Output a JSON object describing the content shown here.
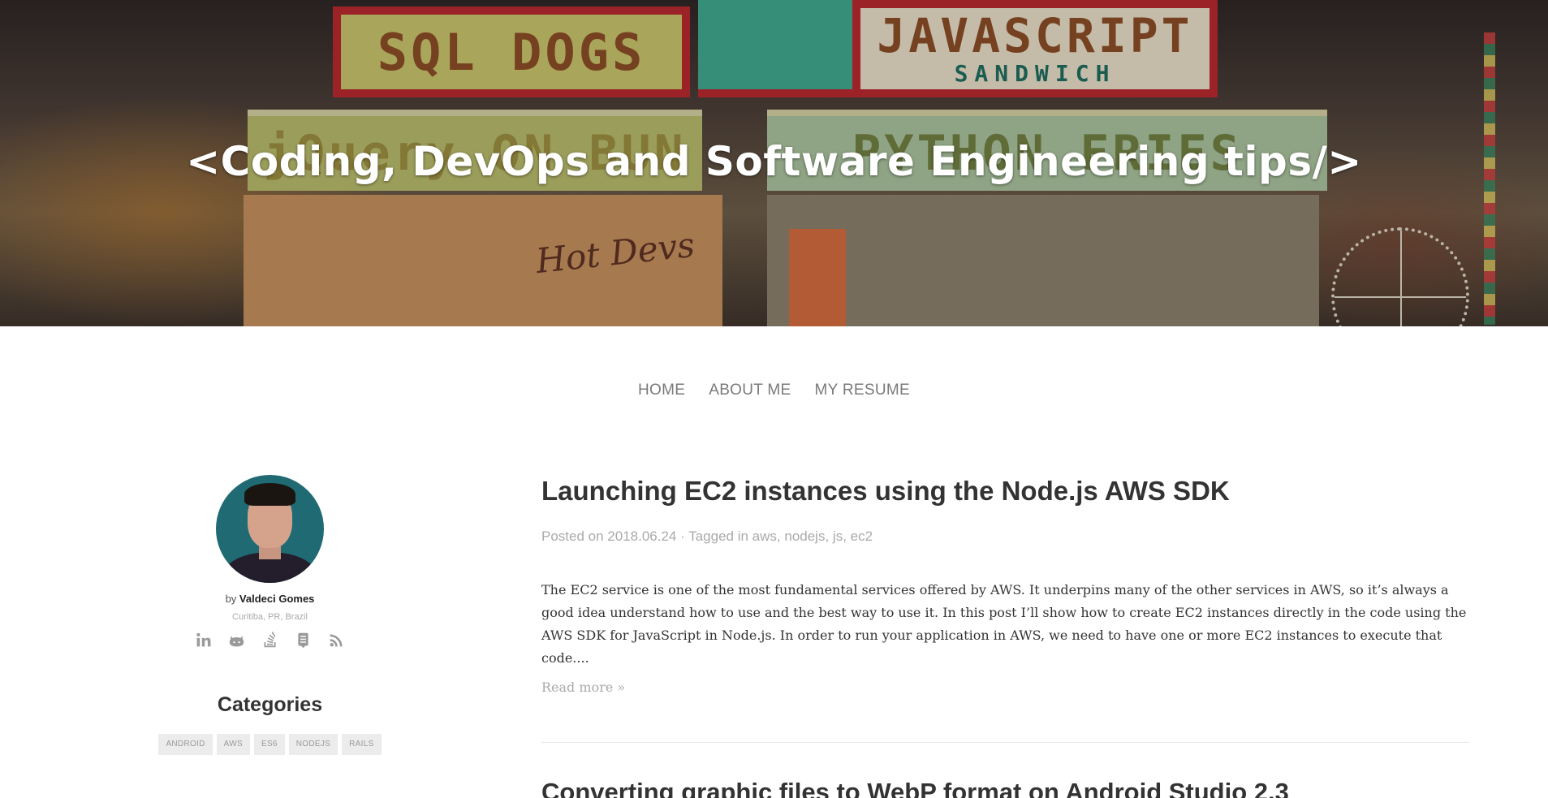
{
  "hero": {
    "title": "<Coding, DevOps and Software Engineering tips/>",
    "image_signs": {
      "sql": "SQL DOGS",
      "js": "JAVASCRIPT",
      "js_sub": "SANDWICH",
      "left": "jQuery ON BUN",
      "right": "PYTHON FRIES",
      "hotdevs": "Hot Devs"
    }
  },
  "nav": {
    "items": [
      "HOME",
      "ABOUT ME",
      "MY RESUME"
    ]
  },
  "sidebar": {
    "by": "by",
    "author": "Valdeci Gomes",
    "location": "Curitiba, PR, Brazil",
    "social_icons": [
      "linkedin-icon",
      "github-icon",
      "stackoverflow-icon",
      "blog-icon",
      "rss-icon"
    ],
    "categories_title": "Categories",
    "categories": [
      "ANDROID",
      "AWS",
      "ES6",
      "NODEJS",
      "RAILS"
    ]
  },
  "posts": [
    {
      "title": "Launching EC2 instances using the Node.js AWS SDK",
      "posted_on_label": "Posted on",
      "date": "2018.06.24",
      "tagged_label": "· Tagged in",
      "tags": [
        "aws",
        "nodejs",
        "js",
        "ec2"
      ],
      "excerpt": "The EC2 service is one of the most fundamental services offered by AWS. It underpins many of the other services in AWS, so it’s always a good idea understand how to use and the best way to use it. In this post I’ll show how to create EC2 instances directly in the code using the AWS SDK for JavaScript in Node.js. In order to run your application in AWS, we need to have one or more EC2 instances to execute that code....",
      "read_more": "Read more »"
    },
    {
      "title": "Converting graphic files to WebP format on Android Studio 2.3"
    }
  ],
  "colors": {
    "text": "#333333",
    "muted": "#aaaaaa",
    "nav": "#7a7a7a",
    "tag_bg": "#ececec"
  }
}
